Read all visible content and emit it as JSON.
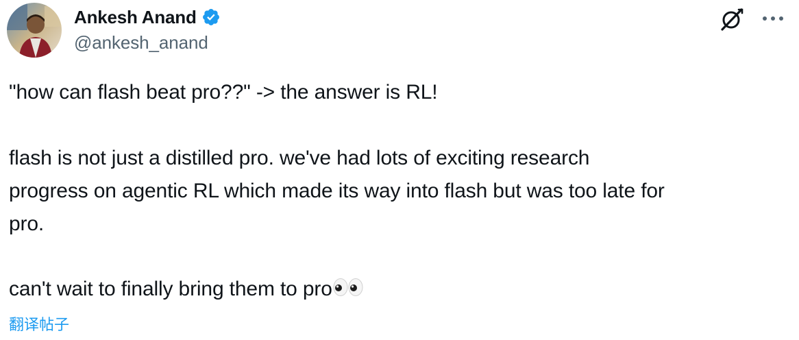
{
  "author": {
    "display_name": "Ankesh Anand",
    "handle": "@ankesh_anand",
    "verified": true,
    "verified_color": "#1d9bf0"
  },
  "header_actions": {
    "grok_icon": "grok-icon",
    "more_icon": "more-options-icon"
  },
  "tweet": {
    "line1": "\"how can flash beat pro??\" -> the answer is RL!",
    "line2": "flash is not just a distilled pro. we've had lots of exciting research",
    "line3": "progress on agentic RL which made its way into flash but was too late for",
    "line4": "pro.",
    "line5": "can't wait to finally bring them to pro",
    "emoji": "eyes-emoji"
  },
  "translate_label": "翻译帖子",
  "colors": {
    "text": "#0f1419",
    "secondary": "#536471",
    "link": "#1d9bf0"
  }
}
